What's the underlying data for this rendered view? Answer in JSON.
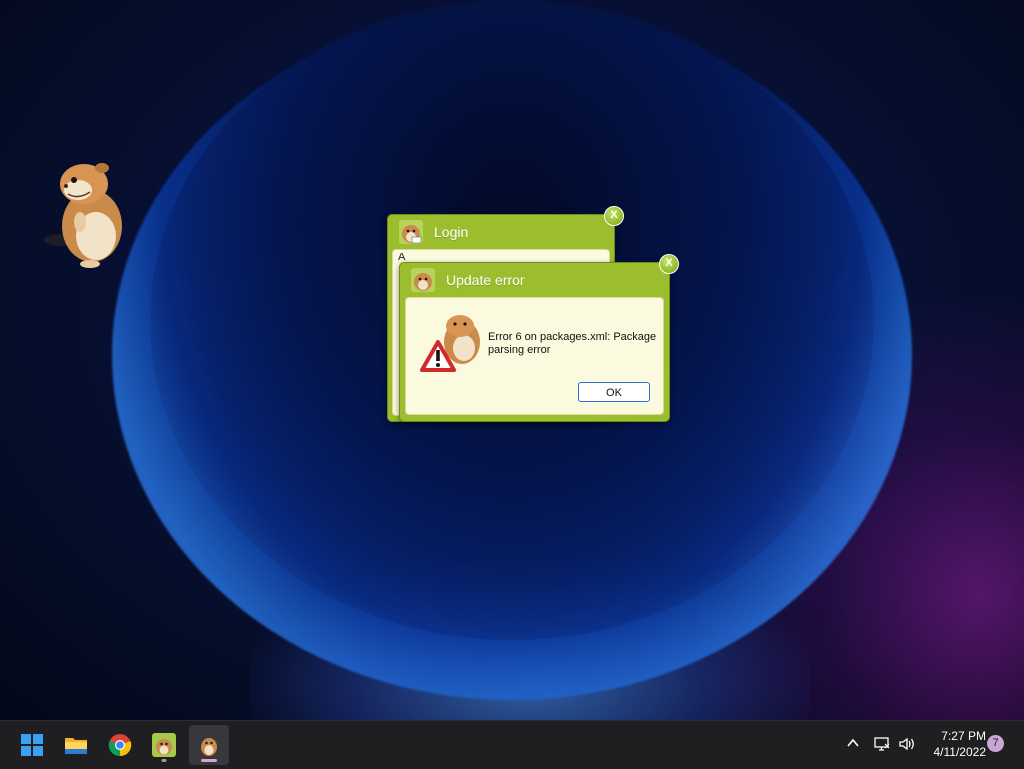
{
  "desktop": {
    "pet": {
      "icon": "hamster-pet-icon"
    }
  },
  "login_window": {
    "title": "Login",
    "icon": "hamster-window-icon",
    "close_label": "X",
    "hidden_text": "A"
  },
  "update_window": {
    "title": "Update error",
    "icon": "hamster-window-icon",
    "close_label": "X",
    "message": "Error 6 on packages.xml: Package parsing error",
    "ok_label": "OK",
    "illustration": "hamster-warning-icon"
  },
  "taskbar": {
    "items": [
      {
        "name": "start",
        "icon": "windows-logo-icon"
      },
      {
        "name": "file-explorer",
        "icon": "folder-icon"
      },
      {
        "name": "chrome",
        "icon": "chrome-icon"
      },
      {
        "name": "hamster-app",
        "icon": "hamster-app-icon"
      },
      {
        "name": "hamster-running",
        "icon": "hamster-app-icon",
        "active": true
      }
    ],
    "tray": {
      "time": "7:27 PM",
      "date": "4/11/2022",
      "notifications": "7"
    }
  },
  "colors": {
    "dialog_green": "#9cbe2e",
    "dialog_panel": "#fbfade",
    "ok_border": "#2f6fd6",
    "taskbar": "#1f1f22"
  }
}
